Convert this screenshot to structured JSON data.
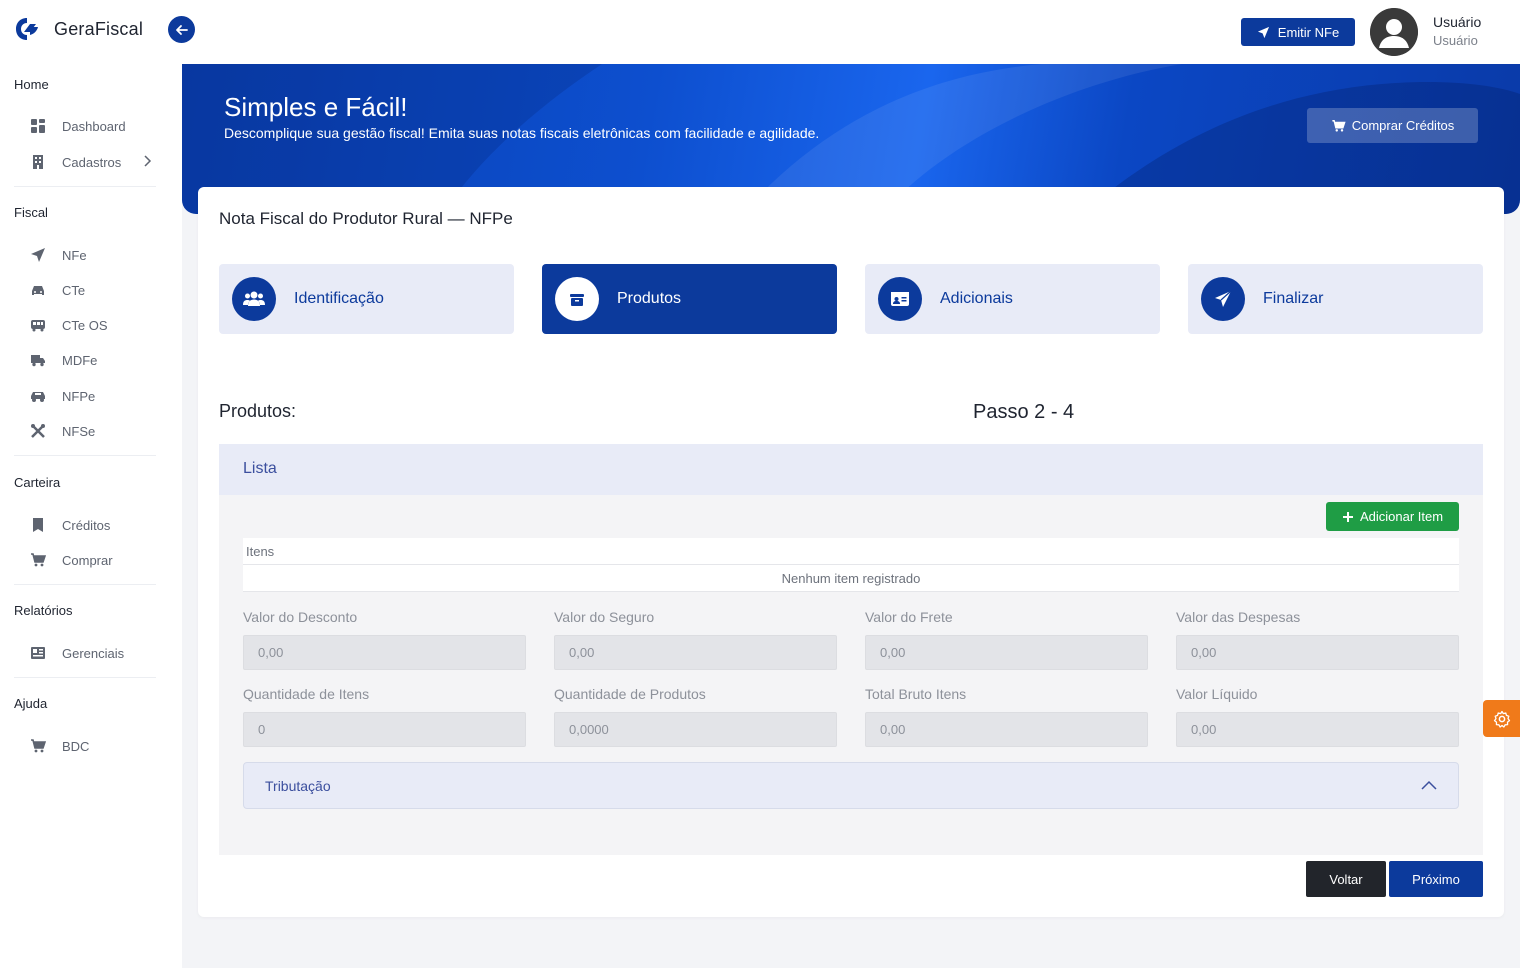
{
  "app": {
    "name": "GeraFiscal"
  },
  "header": {
    "emit_button": "Emitir NFe",
    "user_name": "Usuário",
    "user_role": "Usuário"
  },
  "sidebar": {
    "sections": [
      {
        "title": "Home",
        "items": [
          {
            "label": "Dashboard",
            "icon": "dashboard-icon"
          },
          {
            "label": "Cadastros",
            "icon": "building-icon"
          }
        ]
      },
      {
        "title": "Fiscal",
        "items": [
          {
            "label": "NFe",
            "icon": "send-icon"
          },
          {
            "label": "CTe",
            "icon": "car-icon"
          },
          {
            "label": "CTe OS",
            "icon": "bus-icon"
          },
          {
            "label": "MDFe",
            "icon": "truck-icon"
          },
          {
            "label": "NFPe",
            "icon": "tractor-icon"
          },
          {
            "label": "NFSe",
            "icon": "tools-icon"
          }
        ]
      },
      {
        "title": "Carteira",
        "items": [
          {
            "label": "Créditos",
            "icon": "bookmark-icon"
          },
          {
            "label": "Comprar",
            "icon": "cart-icon"
          }
        ]
      },
      {
        "title": "Relatórios",
        "items": [
          {
            "label": "Gerenciais",
            "icon": "report-icon"
          }
        ]
      },
      {
        "title": "Ajuda",
        "items": [
          {
            "label": "BDC",
            "icon": "cart-icon"
          }
        ]
      }
    ]
  },
  "hero": {
    "title": "Simples e Fácil!",
    "subtitle": "Descomplique sua gestão fiscal! Emita suas notas fiscais eletrônicas com facilidade e agilidade.",
    "buy_button": "Comprar Créditos"
  },
  "card": {
    "title": "Nota Fiscal do Produtor Rural — NFPe",
    "steps": [
      {
        "label": "Identificação",
        "icon": "users-icon",
        "active": false
      },
      {
        "label": "Produtos",
        "icon": "box-icon",
        "active": true
      },
      {
        "label": "Adicionais",
        "icon": "id-card-icon",
        "active": false
      },
      {
        "label": "Finalizar",
        "icon": "send-icon",
        "active": false
      }
    ],
    "section_title": "Produtos:",
    "step_count": "Passo 2 - 4",
    "lista": {
      "title": "Lista",
      "add_button": "Adicionar Item",
      "table_header": "Itens",
      "empty_text": "Nenhum item registrado"
    },
    "fields": [
      {
        "label": "Valor do Desconto",
        "value": "0,00"
      },
      {
        "label": "Valor do Seguro",
        "value": "0,00"
      },
      {
        "label": "Valor do Frete",
        "value": "0,00"
      },
      {
        "label": "Valor das Despesas",
        "value": "0,00"
      },
      {
        "label": "Quantidade de Itens",
        "value": "0"
      },
      {
        "label": "Quantidade de Produtos",
        "value": "0,0000"
      },
      {
        "label": "Total Bruto Itens",
        "value": "0,00"
      },
      {
        "label": "Valor Líquido",
        "value": "0,00"
      }
    ],
    "tributacao": "Tributação",
    "back_button": "Voltar",
    "next_button": "Próximo"
  },
  "colors": {
    "primary": "#0c3a9c",
    "success": "#1f9d45",
    "accent": "#f07a1a"
  }
}
